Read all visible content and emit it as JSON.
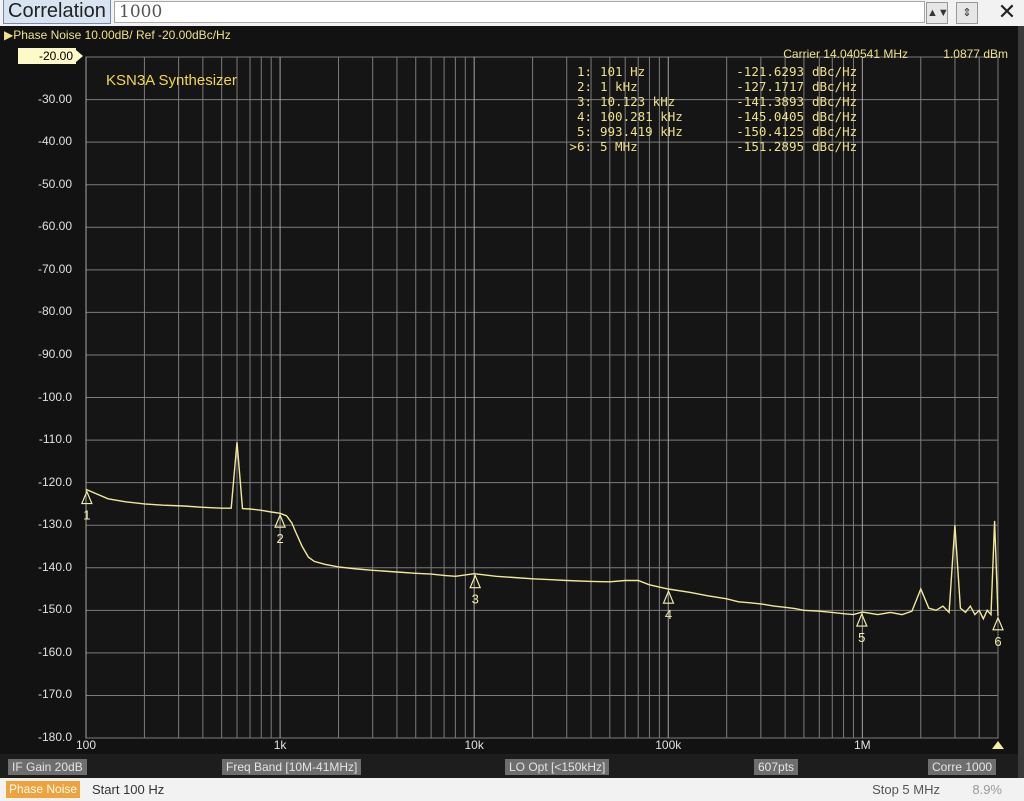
{
  "toolbar": {
    "label": "Correlation",
    "value": "1000",
    "close_glyph": "✕"
  },
  "trace_header": "▶Phase Noise 10.00dB/ Ref -20.00dBc/Hz",
  "ref_level": "-20.00",
  "chart_title": "KSN3A Synthesizer",
  "carrier": "Carrier 14.040541 MHz",
  "carrier_power": "1.0877 dBm",
  "markers": [
    {
      "id": "1:",
      "freq": "101 Hz",
      "value": "-121.6293",
      "unit": "dBc/Hz"
    },
    {
      "id": "2:",
      "freq": "1 kHz",
      "value": "-127.1717",
      "unit": "dBc/Hz"
    },
    {
      "id": "3:",
      "freq": "10.123 kHz",
      "value": "-141.3893",
      "unit": "dBc/Hz"
    },
    {
      "id": "4:",
      "freq": "100.281 kHz",
      "value": "-145.0405",
      "unit": "dBc/Hz"
    },
    {
      "id": "5:",
      "freq": "993.419 kHz",
      "value": "-150.4125",
      "unit": "dBc/Hz"
    },
    {
      "id": ">6:",
      "freq": "5 MHz",
      "value": "-151.2895",
      "unit": "dBc/Hz"
    }
  ],
  "status": {
    "if_gain": "IF Gain 20dB",
    "freq_band": "Freq Band [10M-41MHz]",
    "lo_opt": "LO Opt [<150kHz]",
    "points": "607pts",
    "corre": "Corre 1000"
  },
  "footer": {
    "mode": "Phase Noise",
    "start": "Start 100 Hz",
    "stop": "Stop 5 MHz",
    "extra": "8.9%"
  },
  "colors": {
    "trace": "#f2e89a",
    "grid": "#7c7c7c",
    "marker_text": "#f0e08a",
    "title": "#f0d84a"
  },
  "chart_data": {
    "type": "line",
    "title": "KSN3A Synthesizer",
    "xscale": "log",
    "xlim": [
      100,
      5000000
    ],
    "ylim": [
      -180,
      -20
    ],
    "y_ticks": [
      "-20.00",
      "-30.00",
      "-40.00",
      "-50.00",
      "-60.00",
      "-70.00",
      "-80.00",
      "-90.00",
      "-100.0",
      "-110.0",
      "-120.0",
      "-130.0",
      "-140.0",
      "-150.0",
      "-160.0",
      "-170.0",
      "-180.0"
    ],
    "x_tick_labels": [
      {
        "label": "100",
        "x": 100
      },
      {
        "label": "1k",
        "x": 1000
      },
      {
        "label": "10k",
        "x": 10000
      },
      {
        "label": "100k",
        "x": 100000
      },
      {
        "label": "1M",
        "x": 1000000
      }
    ],
    "grid": true,
    "series": [
      {
        "x": [
          100,
          130,
          160,
          200,
          250,
          320,
          400,
          500,
          560,
          600,
          640,
          700,
          800,
          900,
          1000,
          1080,
          1150,
          1200,
          1300,
          1400,
          1500,
          1700,
          2000,
          2500,
          3000,
          4000,
          5000,
          6000,
          7000,
          8000,
          10000,
          13000,
          16000,
          20000,
          25000,
          30000,
          40000,
          50000,
          60000,
          70000,
          80000,
          100000,
          130000,
          160000,
          200000,
          230000,
          260000,
          300000,
          350000,
          400000,
          450000,
          500000,
          600000,
          700000,
          800000,
          900000,
          1000000,
          1200000,
          1400000,
          1600000,
          1800000,
          2000000,
          2200000,
          2400000,
          2600000,
          2800000,
          3000000,
          3200000,
          3400000,
          3600000,
          3800000,
          4000000,
          4200000,
          4400000,
          4600000,
          4800000,
          5000000
        ],
        "y": [
          -121.6,
          -123.8,
          -124.5,
          -125.0,
          -125.3,
          -125.5,
          -125.8,
          -126.0,
          -126.0,
          -110.5,
          -126.1,
          -126.2,
          -126.5,
          -126.9,
          -127.2,
          -127.8,
          -129.5,
          -131.5,
          -135.0,
          -137.5,
          -138.5,
          -139.2,
          -139.8,
          -140.3,
          -140.6,
          -141.0,
          -141.3,
          -141.5,
          -141.8,
          -142.0,
          -141.4,
          -142.0,
          -142.3,
          -142.6,
          -142.8,
          -143.0,
          -143.2,
          -143.3,
          -143.0,
          -143.0,
          -144.0,
          -145.0,
          -145.8,
          -146.6,
          -147.3,
          -148.0,
          -148.2,
          -148.5,
          -149.0,
          -149.3,
          -149.6,
          -150.0,
          -150.2,
          -150.5,
          -150.8,
          -151.0,
          -150.4,
          -151.0,
          -150.5,
          -151.0,
          -150.2,
          -145.0,
          -149.5,
          -150.0,
          -149.0,
          -150.5,
          -130.0,
          -149.5,
          -150.5,
          -149.0,
          -151.0,
          -150.0,
          -152.0,
          -150.0,
          -151.0,
          -129.0,
          -151.3
        ]
      }
    ],
    "markers": [
      {
        "label": "1",
        "x": 101,
        "y": -121.6293
      },
      {
        "label": "2",
        "x": 1000,
        "y": -127.1717
      },
      {
        "label": "3",
        "x": 10123,
        "y": -141.3893
      },
      {
        "label": "4",
        "x": 100281,
        "y": -145.0405
      },
      {
        "label": "5",
        "x": 993419,
        "y": -150.4125
      },
      {
        "label": "6",
        "x": 5000000,
        "y": -151.2895
      }
    ]
  }
}
